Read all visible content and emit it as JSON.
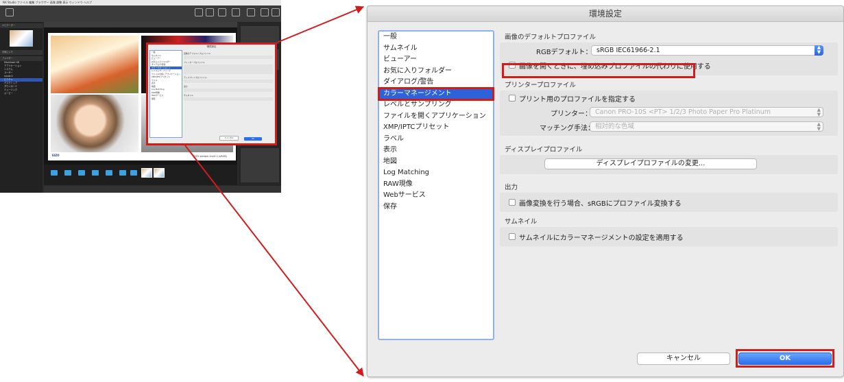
{
  "thumbnail": {
    "menubar_text": "NX Studio  ファイル  編集  ブラウザー  画像  調整  表示  ウィンドウ  ヘルプ",
    "sidebar_sections": [
      "ナビゲーター",
      "お気に入り",
      "フォルダー"
    ],
    "sidebar_rows": [
      "Macintosh HD",
      "アプリケーション",
      "システム",
      "ユーザー",
      "nicole-S",
      "ピクチャ",
      "デスクトップ",
      "ダウンロード",
      "ミュージック",
      "ムービー"
    ],
    "sheet_caption": "EIZO sample chart 2 (sRGB)",
    "logo_text": "EIZO",
    "mini_dialog": {
      "title": "環境設定",
      "items": [
        "一般",
        "サムネイル",
        "ビューアー",
        "お気に入りフォルダー",
        "ダイアログ/警告",
        "カラーマネージメント",
        "レベルとサンプリング",
        "ファイルを開くアプリケーション",
        "XMP/IPTCプリセット",
        "ラベル",
        "表示",
        "地図",
        "Log Matching",
        "RAW現像",
        "Webサービス",
        "保存"
      ],
      "cancel_label": "キャンセル",
      "ok_label": "OK"
    }
  },
  "dialog": {
    "title": "環境設定",
    "categories": [
      {
        "label": "一般"
      },
      {
        "label": "サムネイル"
      },
      {
        "label": "ビューアー"
      },
      {
        "label": "お気に入りフォルダー"
      },
      {
        "label": "ダイアログ/警告"
      },
      {
        "label": "カラーマネージメント",
        "selected": true
      },
      {
        "label": "レベルとサンプリング"
      },
      {
        "label": "ファイルを開くアプリケーション"
      },
      {
        "label": "XMP/IPTCプリセット"
      },
      {
        "label": "ラベル"
      },
      {
        "label": "表示"
      },
      {
        "label": "地図"
      },
      {
        "label": "Log Matching"
      },
      {
        "label": "RAW現像"
      },
      {
        "label": "Webサービス"
      },
      {
        "label": "保存"
      }
    ],
    "default_profile": {
      "section_title": "画像のデフォルトプロファイル",
      "rgb_label": "RGBデフォルト：",
      "rgb_value": "sRGB IEC61966-2.1",
      "embedded_checkbox_label": "画像を開くときに、埋め込みプロファイルの代わりに使用する",
      "embedded_checked": false
    },
    "printer_profile": {
      "section_title": "プリンタープロファイル",
      "specify_checkbox_label": "プリント用のプロファイルを指定する",
      "specify_checked": false,
      "printer_label": "プリンター：",
      "printer_value": "Canon PRO-10S <PT> 1/2/3 Photo Paper Pro Platinum",
      "matching_label": "マッチング手法：",
      "matching_value": "相対的な色域"
    },
    "display_profile": {
      "section_title": "ディスプレイプロファイル",
      "change_button": "ディスプレイプロファイルの変更..."
    },
    "output": {
      "section_title": "出力",
      "convert_checkbox_label": "画像変換を行う場合、sRGBにプロファイル変換する",
      "convert_checked": false
    },
    "thumbnail": {
      "section_title": "サムネイル",
      "apply_checkbox_label": "サムネイルにカラーマネージメントの設定を適用する",
      "apply_checked": false
    },
    "cancel_label": "キャンセル",
    "ok_label": "OK"
  },
  "colors": {
    "highlight": "#d21b1b",
    "selection": "#2f62d9",
    "ok_button": "#2b6ef0"
  }
}
